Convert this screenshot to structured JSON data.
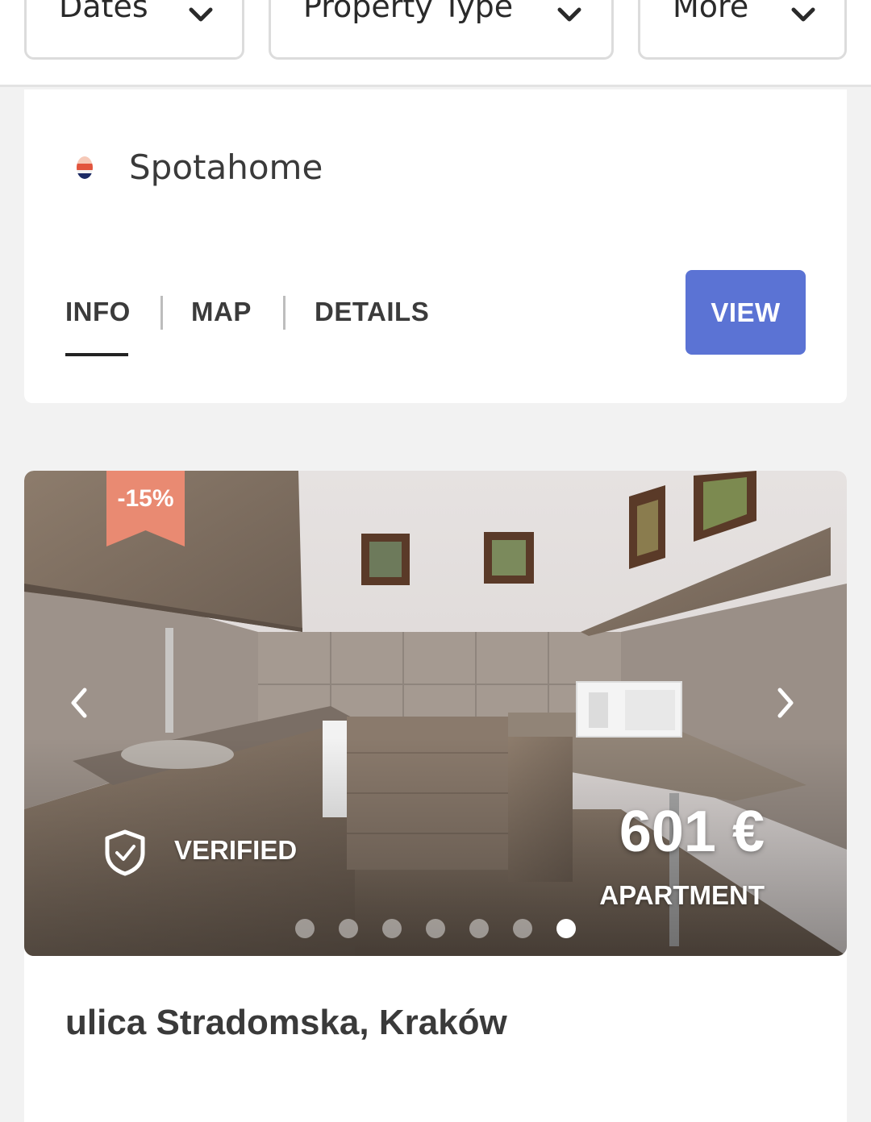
{
  "filters": {
    "dates": "Dates",
    "property_type": "Property Type",
    "more": "More"
  },
  "listing1": {
    "provider": "Spotahome",
    "tabs": [
      "INFO",
      "MAP",
      "DETAILS"
    ],
    "active_tab": "INFO",
    "view_label": "VIEW"
  },
  "listing2": {
    "discount": "-15%",
    "verified": "VERIFIED",
    "price": "601 €",
    "property_type": "APARTMENT",
    "carousel": {
      "total": 7,
      "active_index": 7
    },
    "address": "ulica Stradomska, Kraków"
  },
  "colors": {
    "accent": "#5b73d4",
    "discount_ribbon": "#e98a72"
  },
  "icons": [
    "chevron-down-icon",
    "spotahome-logo",
    "chevron-left-icon",
    "chevron-right-icon",
    "shield-check-icon"
  ]
}
